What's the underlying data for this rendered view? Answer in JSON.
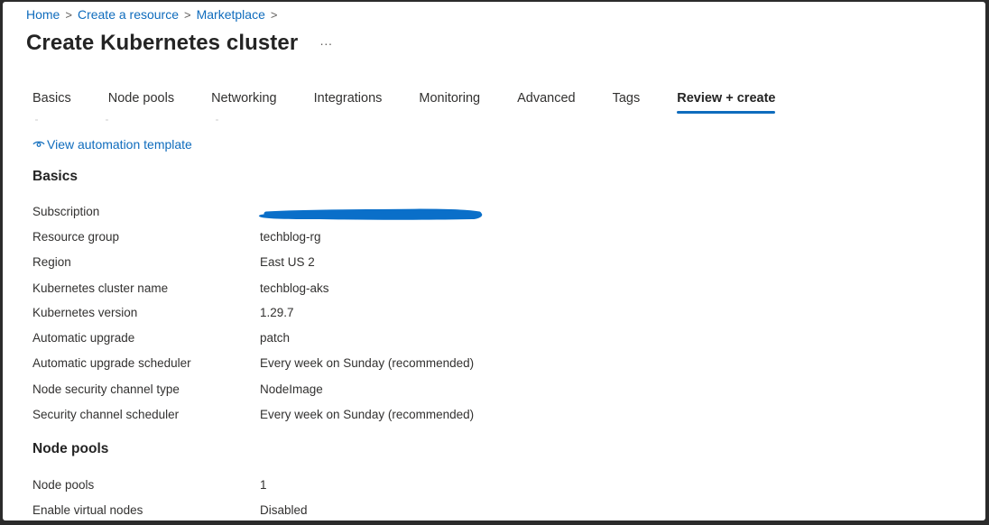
{
  "breadcrumb": [
    {
      "label": "Home"
    },
    {
      "label": "Create a resource"
    },
    {
      "label": "Marketplace"
    }
  ],
  "breadcrumb_separator": ">",
  "page": {
    "title": "Create Kubernetes cluster",
    "more_label": "···"
  },
  "tabs": [
    {
      "label": "Basics",
      "active": false
    },
    {
      "label": "Node pools",
      "active": false
    },
    {
      "label": "Networking",
      "active": false
    },
    {
      "label": "Integrations",
      "active": false
    },
    {
      "label": "Monitoring",
      "active": false
    },
    {
      "label": "Advanced",
      "active": false
    },
    {
      "label": "Tags",
      "active": false
    },
    {
      "label": "Review + create",
      "active": true
    }
  ],
  "automation_link": {
    "label": "View automation template"
  },
  "sections": {
    "basics": {
      "title": "Basics",
      "rows": [
        {
          "label": "Subscription",
          "value": ""
        },
        {
          "label": "Resource group",
          "value": "techblog-rg"
        },
        {
          "label": "Region",
          "value": "East US 2"
        },
        {
          "label": "Kubernetes cluster name",
          "value": "techblog-aks"
        },
        {
          "label": "Kubernetes version",
          "value": "1.29.7"
        },
        {
          "label": "Automatic upgrade",
          "value": "patch"
        },
        {
          "label": "Automatic upgrade scheduler",
          "value": "Every week on Sunday (recommended)"
        },
        {
          "label": "Node security channel type",
          "value": "NodeImage"
        },
        {
          "label": "Security channel scheduler",
          "value": "Every week on Sunday (recommended)"
        }
      ]
    },
    "node_pools": {
      "title": "Node pools",
      "rows": [
        {
          "label": "Node pools",
          "value": "1"
        },
        {
          "label": "Enable virtual nodes",
          "value": "Disabled"
        }
      ]
    }
  },
  "colors": {
    "accent": "#0f6cbd",
    "redaction": "#0a6fc9",
    "frame": "#2b2b2b"
  }
}
